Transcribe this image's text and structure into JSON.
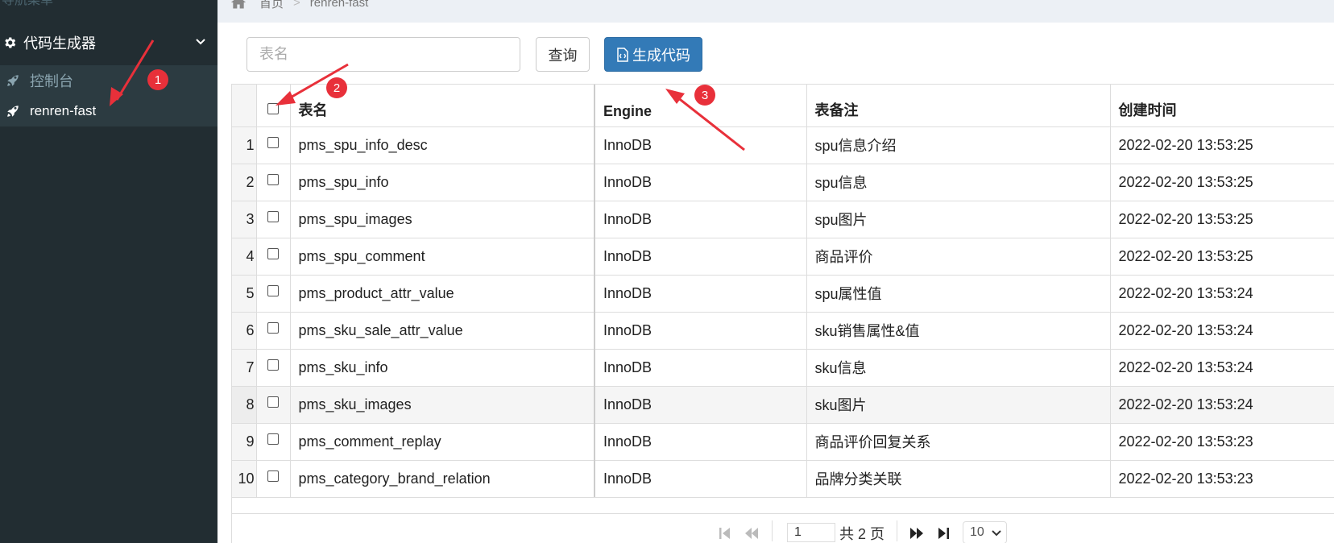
{
  "sidebar": {
    "header": "导航菜单",
    "group_label": "代码生成器",
    "items": [
      {
        "label": "控制台"
      },
      {
        "label": "renren-fast"
      }
    ]
  },
  "breadcrumb": {
    "home": "首页",
    "separator": ">",
    "current": "renren-fast"
  },
  "toolbar": {
    "search_placeholder": "表名",
    "query_label": "查询",
    "generate_label": "生成代码"
  },
  "table": {
    "columns": [
      "表名",
      "Engine",
      "表备注",
      "创建时间"
    ],
    "rows": [
      {
        "n": "1",
        "name": "pms_spu_info_desc",
        "engine": "InnoDB",
        "comment": "spu信息介绍",
        "created": "2022-02-20 13:53:25"
      },
      {
        "n": "2",
        "name": "pms_spu_info",
        "engine": "InnoDB",
        "comment": "spu信息",
        "created": "2022-02-20 13:53:25"
      },
      {
        "n": "3",
        "name": "pms_spu_images",
        "engine": "InnoDB",
        "comment": "spu图片",
        "created": "2022-02-20 13:53:25"
      },
      {
        "n": "4",
        "name": "pms_spu_comment",
        "engine": "InnoDB",
        "comment": "商品评价",
        "created": "2022-02-20 13:53:25"
      },
      {
        "n": "5",
        "name": "pms_product_attr_value",
        "engine": "InnoDB",
        "comment": "spu属性值",
        "created": "2022-02-20 13:53:24"
      },
      {
        "n": "6",
        "name": "pms_sku_sale_attr_value",
        "engine": "InnoDB",
        "comment": "sku销售属性&值",
        "created": "2022-02-20 13:53:24"
      },
      {
        "n": "7",
        "name": "pms_sku_info",
        "engine": "InnoDB",
        "comment": "sku信息",
        "created": "2022-02-20 13:53:24"
      },
      {
        "n": "8",
        "name": "pms_sku_images",
        "engine": "InnoDB",
        "comment": "sku图片",
        "created": "2022-02-20 13:53:24"
      },
      {
        "n": "9",
        "name": "pms_comment_replay",
        "engine": "InnoDB",
        "comment": "商品评价回复关系",
        "created": "2022-02-20 13:53:23"
      },
      {
        "n": "10",
        "name": "pms_category_brand_relation",
        "engine": "InnoDB",
        "comment": "品牌分类关联",
        "created": "2022-02-20 13:53:23"
      }
    ]
  },
  "pager": {
    "current_page": "1",
    "total_text": "共 2 页",
    "page_size": "10"
  },
  "annotations": {
    "badges": [
      "1",
      "2",
      "3"
    ],
    "color": "#e8303a"
  },
  "icons": {
    "menu_group": "gear-icon",
    "menu_item": "rocket-icon",
    "home": "home-icon",
    "generate": "file-code-icon"
  }
}
